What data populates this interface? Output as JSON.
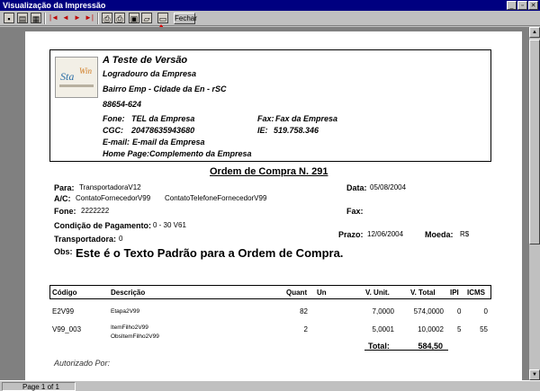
{
  "window": {
    "title": "Visualização da Impressão",
    "buttons": [
      "_",
      "▫",
      "✕"
    ]
  },
  "toolbar": {
    "icons": [
      "page-fit-icon",
      "page-width-icon",
      "page-zoom-icon",
      "first-page-icon",
      "prev-page-icon",
      "next-page-icon",
      "last-page-icon",
      "print-setup-icon",
      "print-icon",
      "save-icon",
      "open-icon",
      "page-icon"
    ],
    "nav_first": "|◄",
    "nav_prev": "◄",
    "nav_next": "►",
    "nav_last": "►|",
    "close_label": "Fechar",
    "annotation_color": "#e00000"
  },
  "company": {
    "logo_text_1": "Sta",
    "logo_text_2": "Win",
    "name": "A Teste de Versão",
    "street": "Logradouro da Empresa",
    "city_line": "Bairro Emp  -  Cidade da En - rSC",
    "zip": "88654-624",
    "phone_label": "Fone:",
    "phone": "TEL da Empresa",
    "fax_label": "Fax:",
    "fax": "Fax da Empresa",
    "cgc_label": "CGC:",
    "cgc": "20478635943680",
    "ie_label": "IE:",
    "ie": "519.758.346",
    "email_label": "E-mail:",
    "email": "E-mail da Empresa",
    "homepage_label": "Home Page:",
    "homepage": "Complemento da Empresa"
  },
  "order": {
    "title": "Ordem de Compra N. 291",
    "para_label": "Para:",
    "para": "TransportadoraV12",
    "data_label": "Data:",
    "data": "05/08/2004",
    "ac_label": "A/C:",
    "ac_contact": "ContatoFornecedorV99",
    "ac_phone": "ContatoTelefoneFornecedorV99",
    "fone_label": "Fone:",
    "fone": "2222222",
    "fax_label": "Fax:",
    "cond_label": "Condição de Pagamento:",
    "cond": "0 - 30 V61",
    "transp_label": "Transportadora:",
    "transp": "0",
    "prazo_label": "Prazo:",
    "prazo": "12/06/2004",
    "moeda_label": "Moeda:",
    "moeda": "R$",
    "obs_label": "Obs:",
    "obs": "Este é o Texto Padrão para a Ordem de Compra."
  },
  "table": {
    "headers": {
      "codigo": "Código",
      "descricao": "Descrição",
      "quant": "Quant",
      "un": "Un",
      "vunit": "V. Unit.",
      "vtotal": "V. Total",
      "ipi": "IPI",
      "icms": "ICMS"
    },
    "rows": [
      {
        "codigo": "E2V99",
        "descricao": "Etapa2V99",
        "descricao2": "",
        "quant": "82",
        "un": "",
        "vunit": "7,0000",
        "vtotal": "574,0000",
        "ipi": "0",
        "icms": "0"
      },
      {
        "codigo": "V99_003",
        "descricao": "ItemFilho2V99",
        "descricao2": "ObsItemFilho2V99",
        "quant": "2",
        "un": "",
        "vunit": "5,0001",
        "vtotal": "10,0002",
        "ipi": "5",
        "icms": "55"
      }
    ],
    "total_label": "Total:",
    "total": "584,50"
  },
  "footer": {
    "authorized": "Autorizado Por:"
  },
  "status": {
    "page": "Page 1 of 1"
  }
}
